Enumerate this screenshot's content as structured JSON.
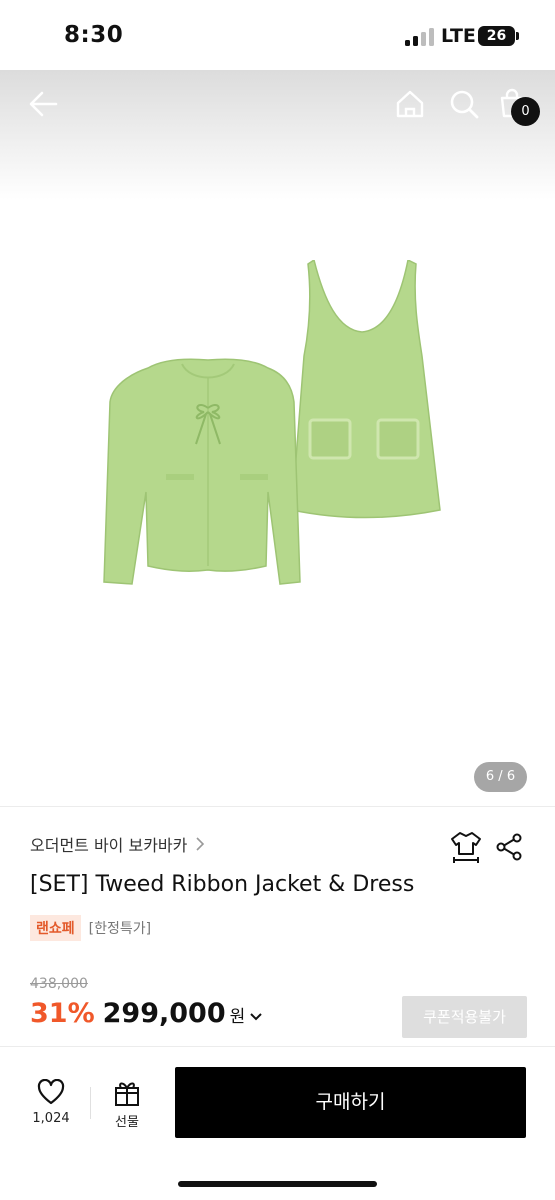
{
  "status_bar": {
    "time": "8:30",
    "network": "LTE",
    "battery": "26"
  },
  "header": {
    "cart_count": "0"
  },
  "gallery": {
    "page_indicator": "6 / 6"
  },
  "product": {
    "brand": "오더먼트 바이 보카바카",
    "title": "[SET] Tweed Ribbon Jacket & Dress",
    "tag_shop": "랜쇼페",
    "tag_limited": "[한정특가]",
    "original_price": "438,000",
    "discount_rate": "31%",
    "sale_price": "299,000",
    "currency": "원",
    "coupon_label": "쿠폰적용불가"
  },
  "bottom_bar": {
    "like_count": "1,024",
    "gift_label": "선물",
    "buy_label": "구매하기"
  },
  "colors": {
    "accent": "#f0582a",
    "tag_background": "#fde8df",
    "garment": "#b5d88c",
    "buy_button": "#000000"
  }
}
